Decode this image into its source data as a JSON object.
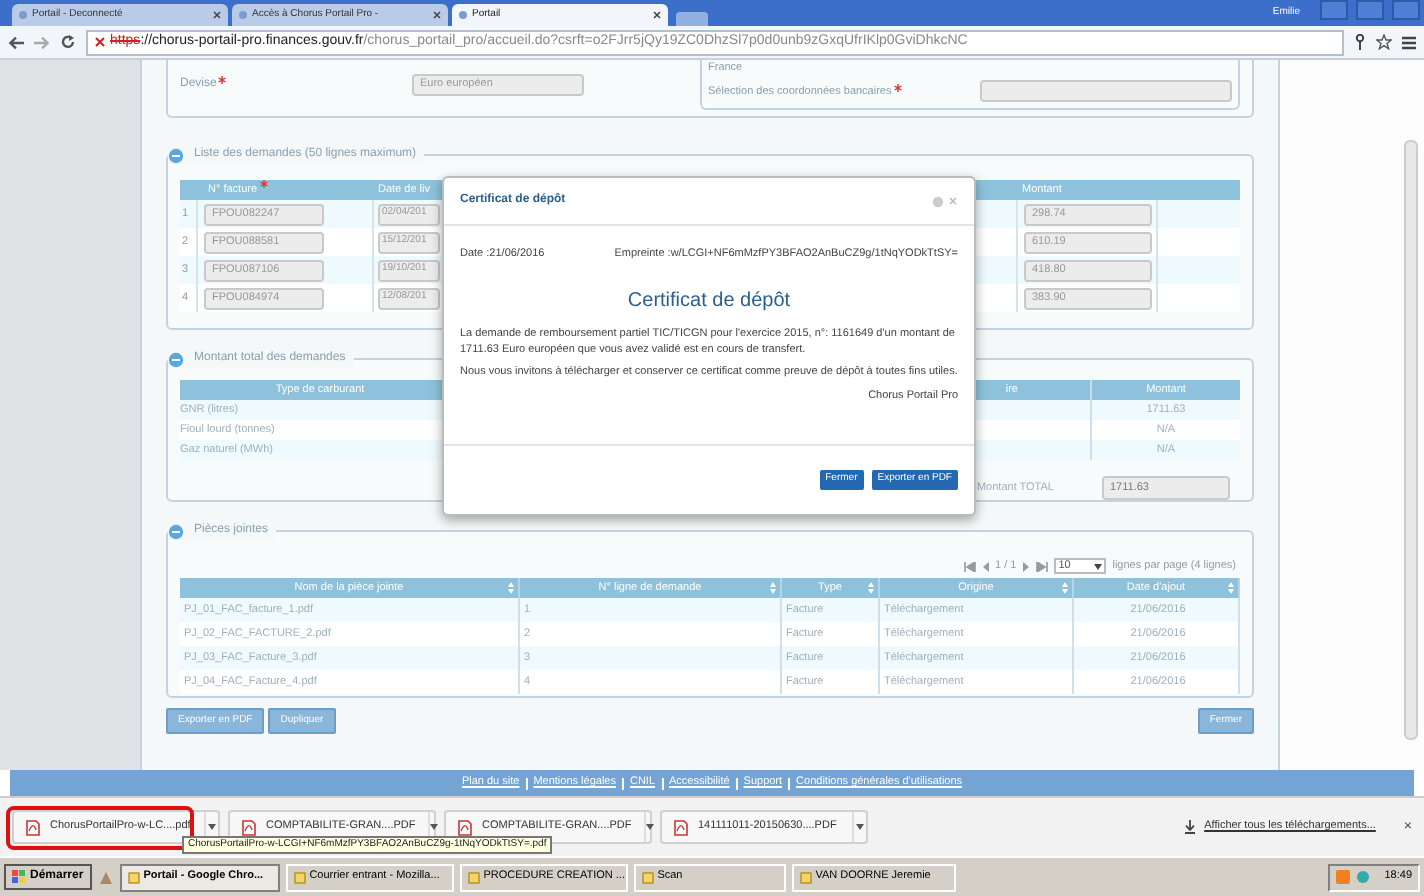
{
  "browser": {
    "tabs": [
      {
        "label": "Portail - Deconnecté",
        "selected": false
      },
      {
        "label": "Accès à Chorus Portail Pro -",
        "selected": false
      },
      {
        "label": "Portail",
        "selected": true
      }
    ],
    "user": "Emilie",
    "url": {
      "scheme": "https",
      "host": "://chorus-portail-pro.finances.gouv.fr",
      "path": "/chorus_portail_pro/accueil.do?csrft=o2FJrr5jQy19ZC0DhzSl7p0d0unb9zGxqUfrIKlp0GviDhkcNC"
    }
  },
  "form": {
    "devise": {
      "label": "Devise",
      "required": true,
      "value": "Euro européen"
    },
    "country": "France",
    "bank": {
      "label": "Sélection des coordonnées bancaires",
      "required": true
    }
  },
  "demandes": {
    "title": "Liste des demandes (50 lignes maximum)",
    "columns": [
      {
        "label": "N° facture",
        "required": true
      },
      {
        "label": "Date de liv",
        "required": false
      },
      {
        "label": "Montant",
        "required": false
      }
    ],
    "rows": [
      {
        "num": "1",
        "invoice": "FPOU082247",
        "date": "02/04/201",
        "amount": "298.74"
      },
      {
        "num": "2",
        "invoice": "FPOU088581",
        "date": "15/12/201",
        "amount": "610.19"
      },
      {
        "num": "3",
        "invoice": "FPOU087106",
        "date": "19/10/201",
        "amount": "418.80"
      },
      {
        "num": "4",
        "invoice": "FPOU084974",
        "date": "12/08/201",
        "amount": "383.90"
      }
    ]
  },
  "totals": {
    "title": "Montant total des demandes",
    "columns": [
      "Type de carburant",
      "ire",
      "Montant"
    ],
    "rows": [
      {
        "fuel": "GNR (litres)",
        "amount": "1711.63"
      },
      {
        "fuel": "Fioul lourd (tonnes)",
        "amount": "N/A"
      },
      {
        "fuel": "Gaz naturel (MWh)",
        "amount": "N/A"
      }
    ],
    "total_label": "Montant TOTAL",
    "total_value": "1711.63"
  },
  "attachments": {
    "title": "Pièces jointes",
    "pager": {
      "page": "1 / 1",
      "per_page": "10",
      "summary": "lignes par page (4 lignes)"
    },
    "columns": [
      "Nom de la pièce jointe",
      "N° ligne de demande",
      "Type",
      "Origine",
      "Date d'ajout"
    ],
    "rows": [
      {
        "name": "PJ_01_FAC_facture_1.pdf",
        "line": "1",
        "type": "Facture",
        "origin": "Téléchargement",
        "date": "21/06/2016"
      },
      {
        "name": "PJ_02_FAC_FACTURE_2.pdf",
        "line": "2",
        "type": "Facture",
        "origin": "Téléchargement",
        "date": "21/06/2016"
      },
      {
        "name": "PJ_03_FAC_Facture_3.pdf",
        "line": "3",
        "type": "Facture",
        "origin": "Téléchargement",
        "date": "21/06/2016"
      },
      {
        "name": "PJ_04_FAC_Facture_4.pdf",
        "line": "4",
        "type": "Facture",
        "origin": "Téléchargement",
        "date": "21/06/2016"
      }
    ]
  },
  "actions": [
    "Exporter en PDF",
    "Dupliquer"
  ],
  "close_button": "Fermer",
  "footer_links": [
    "Plan du site",
    "Mentions légales",
    "CNIL",
    "Accessibilité",
    "Support",
    "Conditions générales d'utilisations"
  ],
  "dialog": {
    "title": "Certificat de dépôt",
    "date": "Date :21/06/2016",
    "fingerprint": "Empreinte :w/LCGI+NF6mMzfPY3BFAO2AnBuCZ9g/1tNqYODkTtSY=",
    "heading": "Certificat de dépôt",
    "paragraphs": [
      "La demande de remboursement partiel TIC/TICGN pour l'exercice 2015, n°: 1161649 d'un montant de 1711.63 Euro européen que vous avez validé est en cours de transfert.",
      "Nous vous invitons à télécharger et conserver ce certificat comme preuve de dépôt à toutes fins utiles."
    ],
    "signature": "Chorus Portail Pro",
    "buttons": [
      "Fermer",
      "Exporter en PDF"
    ]
  },
  "downloads": {
    "items": [
      {
        "label": "ChorusPortailPro-w-LC....pdf",
        "highlighted": true
      },
      {
        "label": "COMPTABILITE-GRAN....PDF",
        "highlighted": false
      },
      {
        "label": "COMPTABILITE-GRAN....PDF",
        "highlighted": false
      },
      {
        "label": "141111011-20150630....PDF",
        "highlighted": false
      }
    ],
    "tooltip": "ChorusPortailPro-w-LCGI+NF6mMzfPY3BFAO2AnBuCZ9g-1tNqYODkTtSY=.pdf",
    "show_all": "Afficher tous les téléchargements...",
    "close": "×"
  },
  "taskbar": {
    "start": "Démarrer",
    "items": [
      {
        "label": "Portail - Google Chro...",
        "selected": true
      },
      {
        "label": "Courrier entrant - Mozilla...",
        "selected": false
      },
      {
        "label": "PROCEDURE CREATION ...",
        "selected": false
      },
      {
        "label": "Scan",
        "selected": false
      },
      {
        "label": "VAN DOORNE Jeremie",
        "selected": false
      }
    ],
    "clock": "18:49"
  }
}
